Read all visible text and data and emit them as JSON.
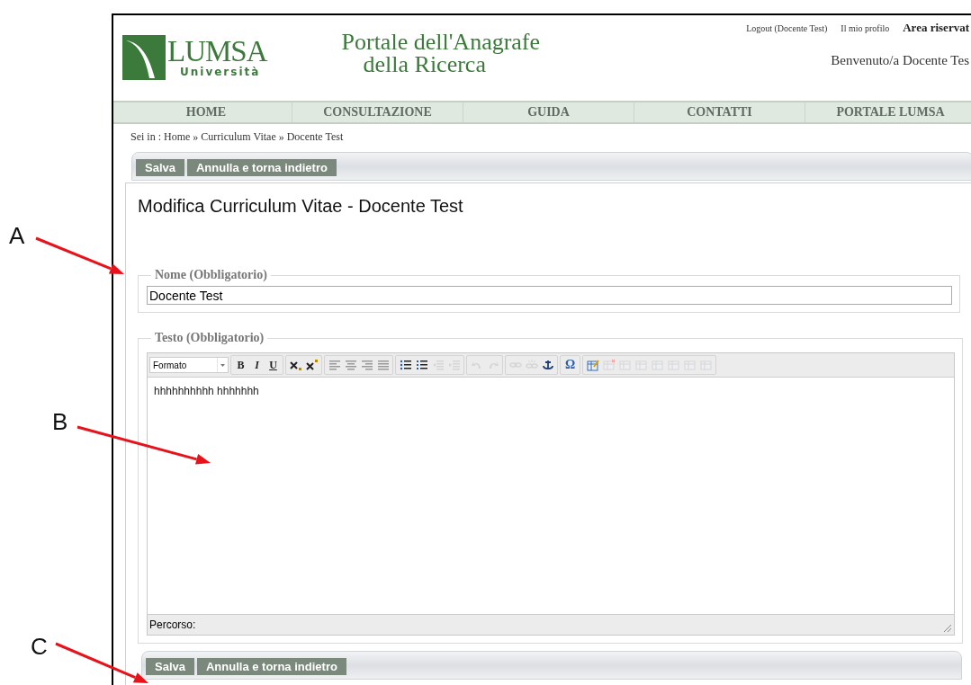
{
  "header": {
    "logo": {
      "name": "LUMSA",
      "subtitle": "Università"
    },
    "title_lines": [
      "Portale dell'Anagrafe",
      "della Ricerca"
    ],
    "top_links": [
      "Logout (Docente Test)",
      "Il mio profilo"
    ],
    "area_label": "Area riservat",
    "welcome": "Benvenuto/a Docente Tes"
  },
  "nav": [
    "HOME",
    "CONSULTAZIONE",
    "GUIDA",
    "CONTATTI",
    "PORTALE LUMSA"
  ],
  "breadcrumb": "Sei in : Home » Curriculum Vitae » Docente Test",
  "top_actions": [
    "Salva",
    "Annulla e torna indietro"
  ],
  "page_title": "Modifica Curriculum Vitae - Docente Test",
  "name_field": {
    "legend": "Nome (Obbligatorio)",
    "value": "Docente Test"
  },
  "text_field": {
    "legend": "Testo (Obbligatorio)",
    "format_select": "Formato",
    "body": "hhhhhhhhhh hhhhhhh",
    "path_label": "Percorso:",
    "toolbar_groups": [
      {
        "buttons": [
          {
            "label": "B",
            "disabled": false
          },
          {
            "label": "I",
            "disabled": false
          },
          {
            "label": "U",
            "disabled": false
          }
        ]
      },
      {
        "buttons": [
          {
            "disabled": false
          },
          {
            "disabled": false
          }
        ]
      },
      {
        "buttons": [
          {
            "disabled": false
          },
          {
            "disabled": false
          },
          {
            "disabled": false
          },
          {
            "disabled": false
          }
        ]
      },
      {
        "buttons": [
          {
            "disabled": false
          },
          {
            "disabled": false
          },
          {
            "disabled": true
          },
          {
            "disabled": true
          }
        ]
      },
      {
        "buttons": [
          {
            "disabled": true
          },
          {
            "disabled": true
          }
        ]
      },
      {
        "buttons": [
          {
            "disabled": true
          },
          {
            "disabled": true
          },
          {
            "disabled": false
          }
        ]
      },
      {
        "buttons": [
          {
            "label": "Ω",
            "disabled": false
          }
        ]
      },
      {
        "buttons": [
          {
            "disabled": false
          },
          {
            "disabled": true
          },
          {
            "disabled": true
          },
          {
            "disabled": true
          },
          {
            "disabled": true
          },
          {
            "disabled": true
          },
          {
            "disabled": true
          },
          {
            "disabled": true
          }
        ]
      }
    ]
  },
  "bottom_actions": [
    "Salva",
    "Annulla e torna indietro"
  ],
  "annotations": [
    {
      "label": "A"
    },
    {
      "label": "B"
    },
    {
      "label": "C"
    }
  ]
}
